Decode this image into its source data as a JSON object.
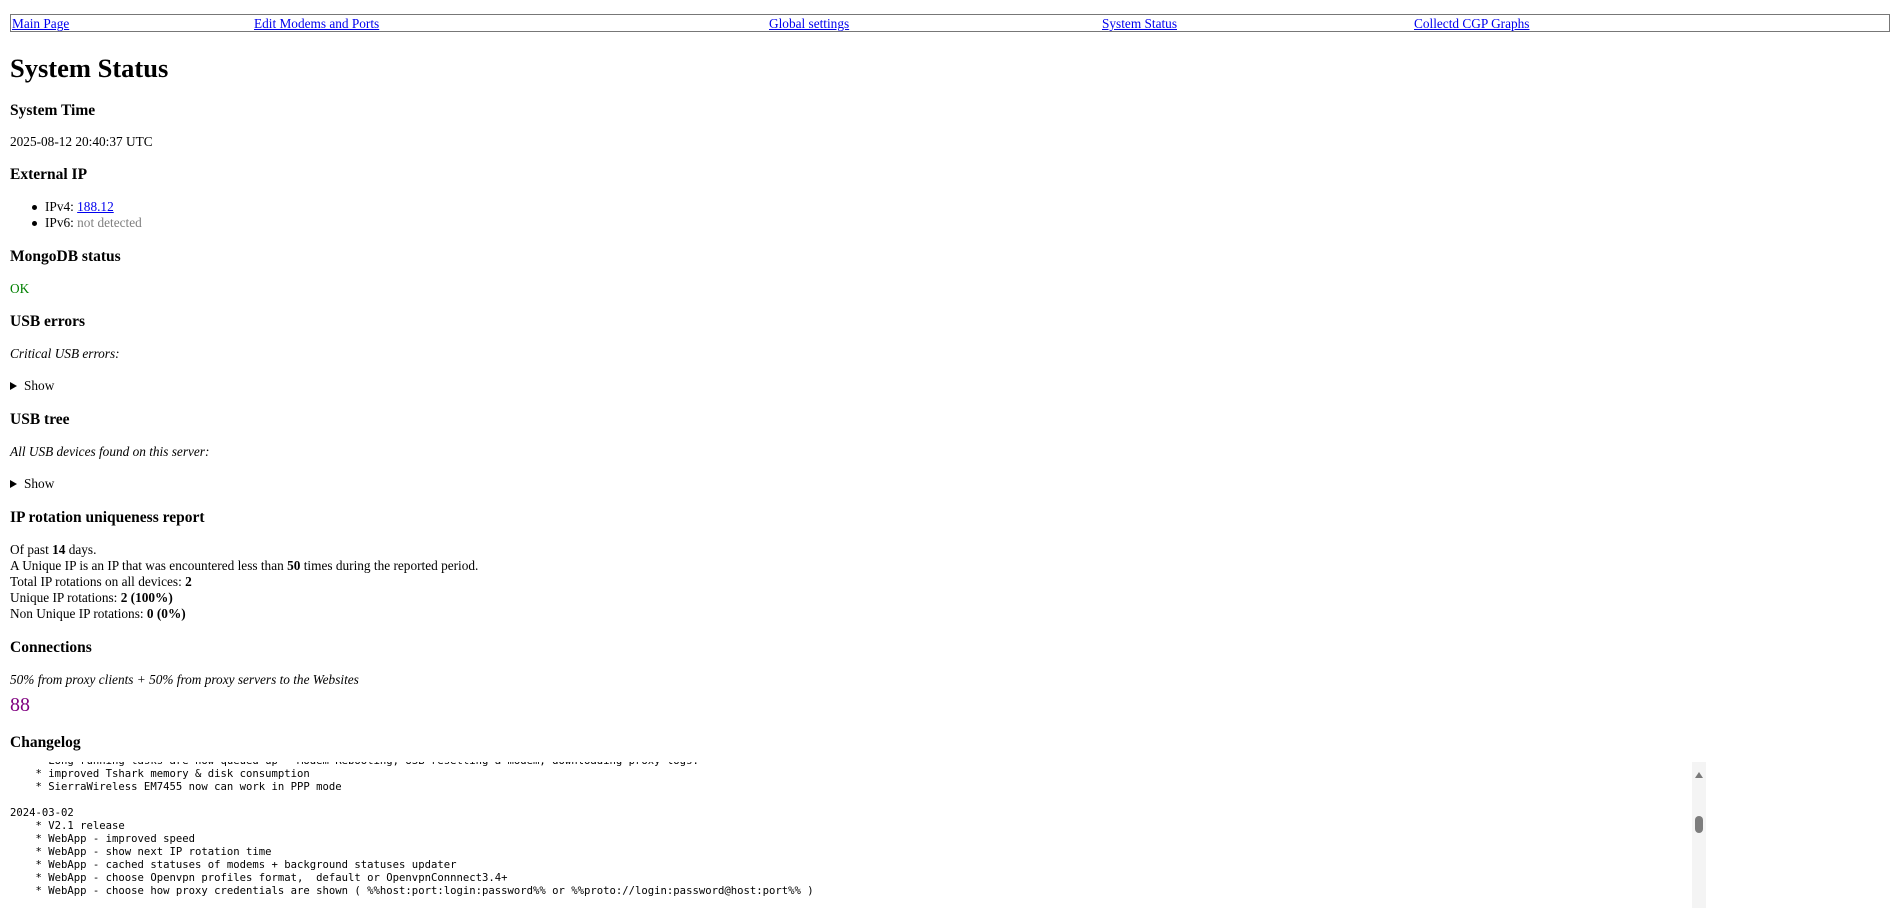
{
  "nav": {
    "items": [
      {
        "label": "Main Page"
      },
      {
        "label": "Edit Modems and Ports"
      },
      {
        "label": "Global settings"
      },
      {
        "label": "System Status"
      },
      {
        "label": "Collectd CGP Graphs"
      }
    ]
  },
  "page_title": "System Status",
  "system_time": {
    "heading": "System Time",
    "value": "2025-08-12 20:40:37 UTC"
  },
  "external_ip": {
    "heading": "External IP",
    "ipv4_label": "IPv4:",
    "ipv4_value": "188.12",
    "ipv6_label": "IPv6:",
    "ipv6_value": "not detected"
  },
  "mongodb": {
    "heading": "MongoDB status",
    "value": "OK"
  },
  "usb_errors": {
    "heading": "USB errors",
    "note": "Critical USB errors:",
    "toggle": "Show"
  },
  "usb_tree": {
    "heading": "USB tree",
    "note": "All USB devices found on this server:",
    "toggle": "Show"
  },
  "ip_rotation": {
    "heading": "IP rotation uniqueness report",
    "days_prefix": "Of past",
    "days": "14",
    "days_suffix": "days.",
    "unique_def_prefix": "A Unique IP is an IP that was encountered less than",
    "unique_def_count": "50",
    "unique_def_suffix": "times during the reported period.",
    "total_label": "Total IP rotations on all devices:",
    "total_value": "2",
    "unique_label": "Unique IP rotations:",
    "unique_value": "2 (100%)",
    "nonunique_label": "Non Unique IP rotations:",
    "nonunique_value": "0 (0%)"
  },
  "connections": {
    "heading": "Connections",
    "note": "50% from proxy clients + 50% from proxy servers to the Websites",
    "value": "88"
  },
  "changelog": {
    "heading": "Changelog",
    "text": "    * Long running tasks are now queued up - Modem Rebooting, USB resetting a modem, downloading proxy logs.\n    * improved Tshark memory & disk consumption\n    * SierraWireless EM7455 now can work in PPP mode\n\n2024-03-02\n    * V2.1 release\n    * WebApp - improved speed\n    * WebApp - show next IP rotation time\n    * WebApp - cached statuses of modems + background statuses updater\n    * WebApp - choose Openvpn profiles format,  default or OpenvpnConnnect3.4+\n    * WebApp - choose how proxy credentials are shown ( %%host:port:login:password%% or %%proto://login:password@host:port%% )"
  }
}
